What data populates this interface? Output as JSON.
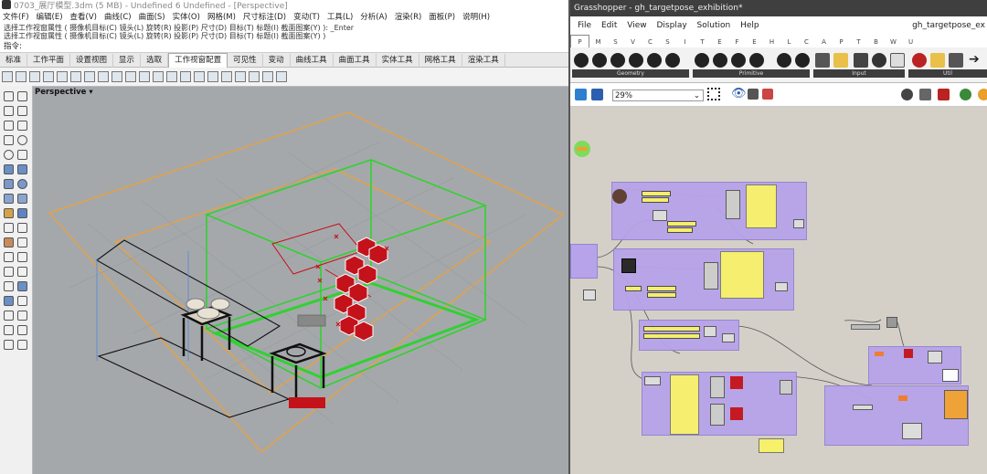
{
  "rhino": {
    "title": "0703_展厅模型.3dm (5 MB) - Undefined 6 Undefined - [Perspective]",
    "menu": [
      "文件(F)",
      "编辑(E)",
      "查看(V)",
      "曲线(C)",
      "曲面(S)",
      "实体(O)",
      "网格(M)",
      "尺寸标注(D)",
      "变动(T)",
      "工具(L)",
      "分析(A)",
      "渲染(R)",
      "面板(P)",
      "说明(H)"
    ],
    "history": [
      "选择工作视窗属性 ( 摄像机目标(C)   镜头(L)   旋转(R)   投影(P)   尺寸(D)   目标(T)   标题(I)   截面图案(Y) ): _Enter",
      "选择工作视窗属性 ( 摄像机目标(C)   镜头(L)   旋转(R)   投影(P)   尺寸(D)   目标(T)   标题(I)   截面图案(Y) )"
    ],
    "command_prompt": "指令:",
    "toolbar_tabs": [
      "标准",
      "工作平面",
      "设置视图",
      "显示",
      "选取",
      "工作视窗配置",
      "可见性",
      "变动",
      "曲线工具",
      "曲面工具",
      "实体工具",
      "网格工具",
      "渲染工具"
    ],
    "active_tab": "工作视窗配置",
    "viewport_label": "Perspective"
  },
  "grasshopper": {
    "title": "Grasshopper - gh_targetpose_exhibition*",
    "doc_name": "gh_targetpose_ex",
    "menu": [
      "File",
      "Edit",
      "View",
      "Display",
      "Solution",
      "Help"
    ],
    "component_tabs": [
      "P",
      "M",
      "S",
      "V",
      "C",
      "S",
      "I",
      "T",
      "E",
      "F",
      "E",
      "H",
      "L",
      "C",
      "A",
      "P",
      "T",
      "B",
      "W",
      "U"
    ],
    "ribbon_groups": [
      "Geometry",
      "Primitive",
      "Input",
      "Util"
    ],
    "zoom": "29%"
  },
  "colors": {
    "accent_orange": "#f0a030",
    "accent_green": "#2fd22f",
    "group_purple": "#b7a3ea",
    "component_yellow": "#f7f06a",
    "component_red": "#c4121b"
  }
}
